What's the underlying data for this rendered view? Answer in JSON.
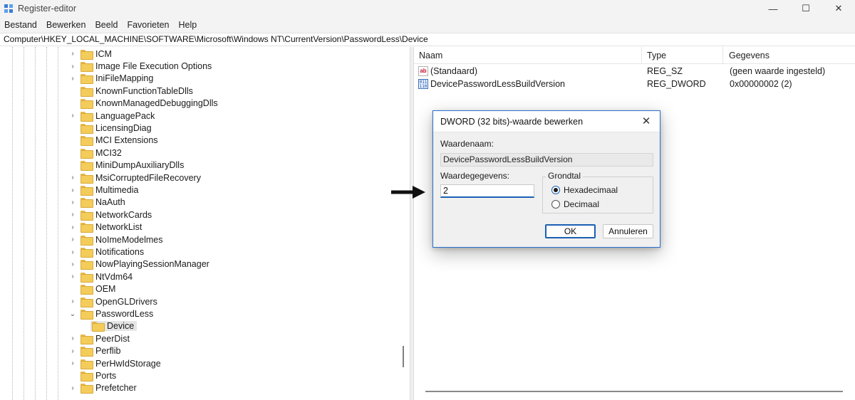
{
  "window": {
    "title": "Register-editor",
    "minimize": "—",
    "maximize": "☐",
    "close": "✕"
  },
  "menu": [
    "Bestand",
    "Bewerken",
    "Beeld",
    "Favorieten",
    "Help"
  ],
  "address": "Computer\\HKEY_LOCAL_MACHINE\\SOFTWARE\\Microsoft\\Windows NT\\CurrentVersion\\PasswordLess\\Device",
  "tree": [
    {
      "label": "ICM",
      "expander": "›"
    },
    {
      "label": "Image File Execution Options",
      "expander": "›"
    },
    {
      "label": "IniFileMapping",
      "expander": "›"
    },
    {
      "label": "KnownFunctionTableDlls",
      "expander": ""
    },
    {
      "label": "KnownManagedDebuggingDlls",
      "expander": ""
    },
    {
      "label": "LanguagePack",
      "expander": "›"
    },
    {
      "label": "LicensingDiag",
      "expander": ""
    },
    {
      "label": "MCI Extensions",
      "expander": ""
    },
    {
      "label": "MCI32",
      "expander": ""
    },
    {
      "label": "MiniDumpAuxiliaryDlls",
      "expander": ""
    },
    {
      "label": "MsiCorruptedFileRecovery",
      "expander": "›"
    },
    {
      "label": "Multimedia",
      "expander": "›"
    },
    {
      "label": "NaAuth",
      "expander": "›"
    },
    {
      "label": "NetworkCards",
      "expander": "›"
    },
    {
      "label": "NetworkList",
      "expander": "›"
    },
    {
      "label": "NoImeModelmes",
      "expander": "›"
    },
    {
      "label": "Notifications",
      "expander": "›"
    },
    {
      "label": "NowPlayingSessionManager",
      "expander": "›"
    },
    {
      "label": "NtVdm64",
      "expander": "›"
    },
    {
      "label": "OEM",
      "expander": ""
    },
    {
      "label": "OpenGLDrivers",
      "expander": "›"
    },
    {
      "label": "PasswordLess",
      "expander": "⌄"
    },
    {
      "label": "Device",
      "expander": "",
      "child": true,
      "selected": true
    },
    {
      "label": "PeerDist",
      "expander": "›"
    },
    {
      "label": "Perflib",
      "expander": "›"
    },
    {
      "label": "PerHwIdStorage",
      "expander": "›"
    },
    {
      "label": "Ports",
      "expander": ""
    },
    {
      "label": "Prefetcher",
      "expander": "›"
    }
  ],
  "list": {
    "headers": {
      "name": "Naam",
      "type": "Type",
      "data": "Gegevens"
    },
    "rows": [
      {
        "icon": "string-value-icon",
        "glyph": "ab",
        "name": "(Standaard)",
        "type": "REG_SZ",
        "data": "(geen waarde ingesteld)"
      },
      {
        "icon": "binary-value-icon",
        "glyph": "011 110",
        "name": "DevicePasswordLessBuildVersion",
        "type": "REG_DWORD",
        "data": "0x00000002 (2)"
      }
    ]
  },
  "dialog": {
    "title": "DWORD (32 bits)-waarde bewerken",
    "close": "✕",
    "name_label": "Waardenaam:",
    "name_value": "DevicePasswordLessBuildVersion",
    "data_label": "Waardegegevens:",
    "data_value": "2",
    "base_label": "Grondtal",
    "base_options": [
      {
        "label": "Hexadecimaal",
        "selected": true
      },
      {
        "label": "Decimaal",
        "selected": false
      }
    ],
    "ok": "OK",
    "cancel": "Annuleren"
  }
}
